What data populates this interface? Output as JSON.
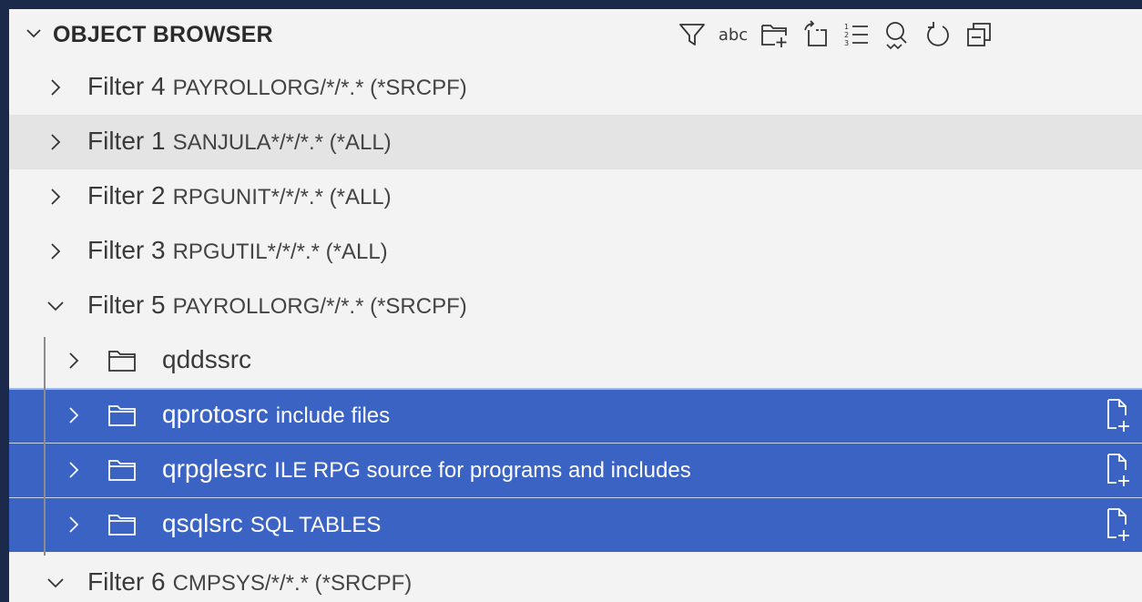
{
  "panel": {
    "title": "OBJECT BROWSER",
    "toolbar_icons": [
      "filter-icon",
      "abc-search-icon",
      "new-folder-icon",
      "import-icon",
      "list-icon",
      "search-icon",
      "refresh-icon",
      "collapse-all-icon"
    ],
    "toolbar_abc": "abc"
  },
  "tree": {
    "filters": [
      {
        "label": "Filter 4",
        "desc": "PAYROLLORG/*/*.* (*SRCPF)",
        "expanded": false
      },
      {
        "label": "Filter 1",
        "desc": "SANJULA*/*/*.* (*ALL)",
        "expanded": false,
        "hover": true
      },
      {
        "label": "Filter 2",
        "desc": "RPGUNIT*/*/*.* (*ALL)",
        "expanded": false
      },
      {
        "label": "Filter 3",
        "desc": "RPGUTIL*/*/*.* (*ALL)",
        "expanded": false
      },
      {
        "label": "Filter 5",
        "desc": "PAYROLLORG/*/*.* (*SRCPF)",
        "expanded": true
      },
      {
        "label": "Filter 6",
        "desc": "CMPSYS/*/*.* (*SRCPF)",
        "expanded": true
      }
    ],
    "children": [
      {
        "label": "qddssrc",
        "desc": "",
        "selected": false
      },
      {
        "label": "qprotosrc",
        "desc": "include files",
        "selected": true
      },
      {
        "label": "qrpglesrc",
        "desc": "ILE RPG source for programs and includes",
        "selected": true
      },
      {
        "label": "qsqlsrc",
        "desc": "SQL TABLES",
        "selected": true
      }
    ]
  },
  "colors": {
    "background": "#1b2a4a",
    "panel": "#f3f3f3",
    "selection": "#3b63c4",
    "hover": "#e4e4e4"
  }
}
